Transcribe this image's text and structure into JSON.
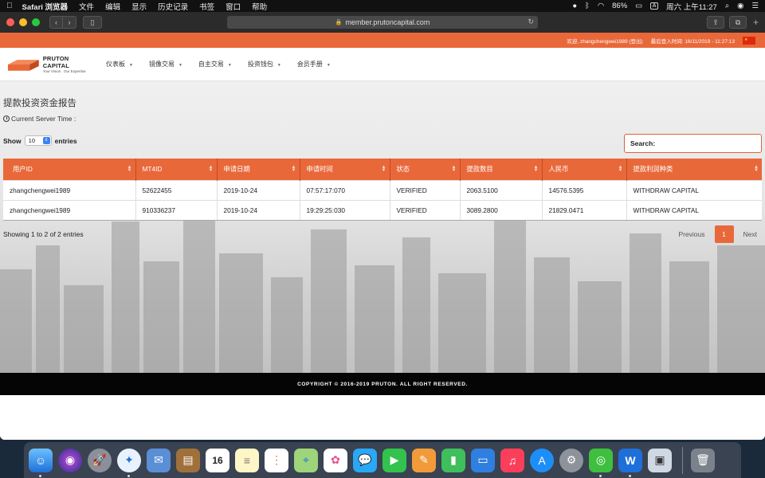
{
  "menubar": {
    "app_name": "Safari 浏览器",
    "items": [
      "文件",
      "编辑",
      "显示",
      "历史记录",
      "书签",
      "窗口",
      "帮助"
    ],
    "battery": "86%",
    "input_source": "A",
    "clock": "周六 上午11:27"
  },
  "browser": {
    "url": "member.prutoncapital.com"
  },
  "site": {
    "welcome": "欢迎, zhangchengwei1989 (登出)",
    "login_time": "最后登入时间: 16/11/2019 - 11:27:13",
    "logo_name": "PRUTON CAPITAL",
    "logo_tagline": "Your Vision . Our Expertise",
    "menu": [
      "仪表板",
      "镜像交易",
      "自主交易",
      "投资钱包",
      "会员手册"
    ]
  },
  "report": {
    "title": "提款投资资金报告",
    "server_time_label": "Current Server Time :",
    "show_label": "Show",
    "entries_label": "entries",
    "page_length": "10",
    "search_label": "Search:",
    "search_value": "",
    "columns": [
      "用户ID",
      "MT4ID",
      "申请日期",
      "申请时间",
      "状态",
      "提款数目",
      "人民币",
      "提款利润种类"
    ],
    "rows": [
      [
        "zhangchengwei1989",
        "52622455",
        "2019-10-24",
        "07:57:17:070",
        "VERIFIED",
        "2063.5100",
        "14576.5395",
        "WITHDRAW CAPITAL"
      ],
      [
        "zhangchengwei1989",
        "910336237",
        "2019-10-24",
        "19:29:25:030",
        "VERIFIED",
        "3089.2800",
        "21829.0471",
        "WITHDRAW CAPITAL"
      ]
    ],
    "info": "Showing 1 to 2 of 2 entries",
    "pagination": {
      "previous": "Previous",
      "current": "1",
      "next": "Next"
    }
  },
  "footer": {
    "copyright": "COPYRIGHT © 2016-2019 PRUTON. ALL RIGHT RESERVED."
  },
  "colors": {
    "accent": "#e9683a",
    "footer_bg": "#050505"
  },
  "dock": {
    "calendar_day": "16",
    "apps": [
      "finder-icon",
      "siri-icon",
      "launchpad-icon",
      "safari-icon",
      "mail-icon",
      "notes-book-icon",
      "calendar-icon",
      "notes-icon",
      "reminders-icon",
      "maps-icon",
      "photos-icon",
      "messages-icon",
      "facetime-icon",
      "pages-icon",
      "numbers-icon",
      "keynote-icon",
      "music-icon",
      "app-store-icon",
      "system-preferences-icon",
      "wechat-icon",
      "wps-icon",
      "preview-icon",
      "trash-icon"
    ]
  }
}
